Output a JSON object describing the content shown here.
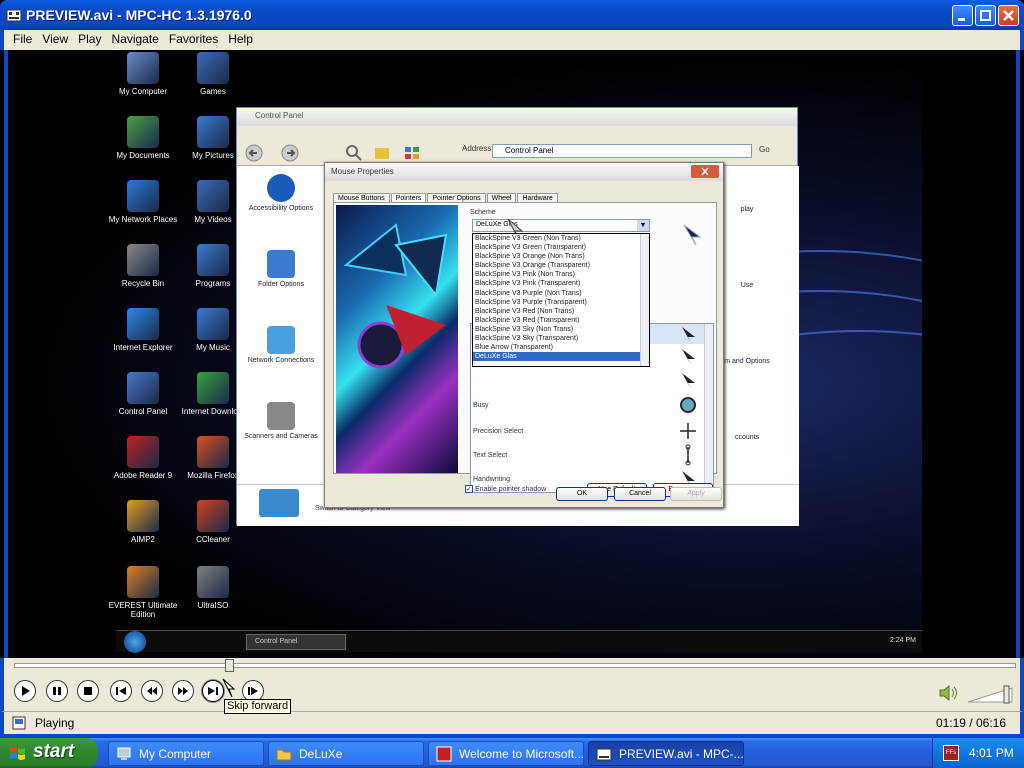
{
  "window": {
    "title": "PREVIEW.avi - MPC-HC 1.3.1976.0"
  },
  "menu": [
    "File",
    "View",
    "Play",
    "Navigate",
    "Favorites",
    "Help"
  ],
  "desktop_icons": [
    {
      "label": "My Computer",
      "color": "#6a8ac8"
    },
    {
      "label": "Games",
      "color": "#3a6ab8"
    },
    {
      "label": "My Documents",
      "color": "#48a048"
    },
    {
      "label": "My Pictures",
      "color": "#3a7ad0"
    },
    {
      "label": "My Network Places",
      "color": "#2a7ad8"
    },
    {
      "label": "My Videos",
      "color": "#3a6ab8"
    },
    {
      "label": "Recycle Bin",
      "color": "#888888"
    },
    {
      "label": "Programs",
      "color": "#3a7ad0"
    },
    {
      "label": "Internet Explorer",
      "color": "#2a8ae8"
    },
    {
      "label": "My Music",
      "color": "#3a7ad0"
    },
    {
      "label": "Control Panel",
      "color": "#4a78c8"
    },
    {
      "label": "Internet Downlo...",
      "color": "#3aa040"
    },
    {
      "label": "Adobe Reader 9",
      "color": "#c02020"
    },
    {
      "label": "Mozilla Firefox",
      "color": "#d85020"
    },
    {
      "label": "AIMP2",
      "color": "#e0a020"
    },
    {
      "label": "CCleaner",
      "color": "#d04020"
    },
    {
      "label": "EVEREST Ultimate Edition",
      "color": "#e08020"
    },
    {
      "label": "UltraISO",
      "color": "#808080"
    }
  ],
  "control_panel": {
    "title": "Control Panel",
    "address_label": "Address",
    "address_value": "Control Panel",
    "go_label": "Go",
    "items": [
      "Accessibility Options",
      "Folder Options",
      "Network Connections",
      "Scanners and Cameras"
    ],
    "right_items": [
      "play",
      "Use",
      "m and Options",
      "ccounts"
    ],
    "bottom_text": "Switch to Category View"
  },
  "mouse_properties": {
    "title": "Mouse Properties",
    "tabs": [
      "Mouse Buttons",
      "Pointers",
      "Pointer Options",
      "Wheel",
      "Hardware"
    ],
    "active_tab": "Pointers",
    "scheme_label": "Scheme",
    "scheme_value": "DeLuXe Glas",
    "scheme_options": [
      "BlackSpine V3 Green (Non Trans)",
      "BlackSpine V3 Green (Transparent)",
      "BlackSpine V3 Orange (Non Trans)",
      "BlackSpine V3 Orange (Transparent)",
      "BlackSpine V3 Pink (Non Trans)",
      "BlackSpine V3 Pink (Transparent)",
      "BlackSpine V3 Purple (Non Trans)",
      "BlackSpine V3 Purple (Transparent)",
      "BlackSpine V3 Red (Non Trans)",
      "BlackSpine V3 Red (Transparent)",
      "BlackSpine V3 Sky (Non Trans)",
      "BlackSpine V3 Sky (Transparent)",
      "Blue Arrow (Transparent)",
      "DeLuXe Glas"
    ],
    "pointer_rows": [
      "Busy",
      "Precision Select",
      "Text Select",
      "Handwriting"
    ],
    "shadow_label": "Enable pointer shadow",
    "use_default_label": "Use Default",
    "browse_label": "Browse...",
    "ok_label": "OK",
    "cancel_label": "Cancel",
    "apply_label": "Apply"
  },
  "inner_taskbar": {
    "button": "Control Panel",
    "clock": "2:24 PM"
  },
  "player": {
    "seek_fraction": 0.212,
    "tooltip": "Skip forward",
    "status": "Playing",
    "time": "01:19 / 06:16",
    "volume_fraction": 0.85,
    "buttons": [
      "play",
      "pause",
      "stop",
      "skip-back",
      "frame-back",
      "frame-forward",
      "skip-forward",
      "frame-step"
    ]
  },
  "taskbar": {
    "start": "start",
    "items": [
      {
        "label": "My Computer",
        "active": false
      },
      {
        "label": "DeLuXe",
        "active": false
      },
      {
        "label": "Welcome to Microsoft...",
        "active": false
      },
      {
        "label": "PREVIEW.avi - MPC-...",
        "active": true
      }
    ],
    "clock": "4:01 PM",
    "tray_icon": "FFs"
  }
}
